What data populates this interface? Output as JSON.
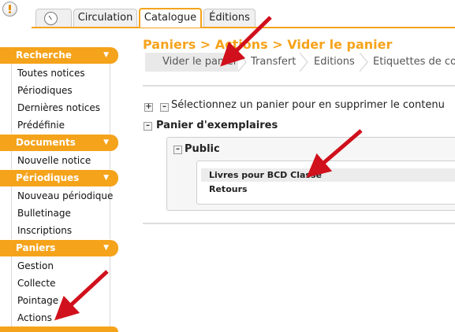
{
  "tabs": {
    "circulation": "Circulation",
    "catalogue": "Catalogue",
    "editions": "Éditions"
  },
  "sidebar": {
    "recherche": {
      "title": "Recherche",
      "items": [
        "Toutes notices",
        "Périodiques",
        "Dernières notices",
        "Prédéfinie"
      ]
    },
    "documents": {
      "title": "Documents",
      "items": [
        "Nouvelle notice"
      ]
    },
    "periodiques": {
      "title": "Périodiques",
      "items": [
        "Nouveau périodique",
        "Bulletinage",
        "Inscriptions"
      ]
    },
    "paniers": {
      "title": "Paniers",
      "items": [
        "Gestion",
        "Collecte",
        "Pointage",
        "Actions"
      ]
    }
  },
  "main": {
    "title": "Paniers > Actions > Vider le panier",
    "breadcrumbs": [
      "Vider le panier",
      "Transfert",
      "Editions",
      "Etiquettes de cote"
    ],
    "select_text": "Sélectionnez un panier pour en supprimer le contenu",
    "group_title": "Panier d'exemplaires",
    "subgroup_title": "Public",
    "baskets": [
      "Livres pour BCD Classe",
      "Retours"
    ]
  },
  "colors": {
    "accent": "#f5a31b",
    "arrow": "#d0101c"
  }
}
